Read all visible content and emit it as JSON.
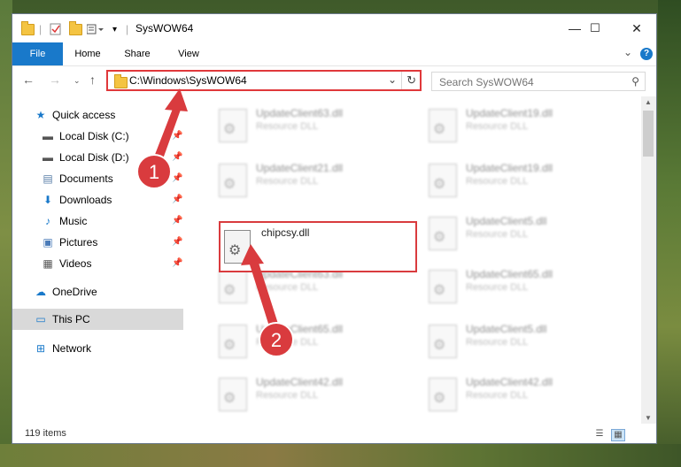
{
  "window": {
    "title": "SysWOW64"
  },
  "controls": {
    "minimize": "—",
    "maximize": "☐",
    "close": "✕"
  },
  "ribbon": {
    "tabs": [
      "File",
      "Home",
      "Share",
      "View"
    ],
    "expand": "⌄",
    "help": "?"
  },
  "address": {
    "path": "C:\\Windows\\SysWOW64"
  },
  "search": {
    "placeholder": "Search SysWOW64"
  },
  "nav": {
    "quick_access": "Quick access",
    "items": [
      {
        "label": "Local Disk (C:)",
        "icon": "drive-icon"
      },
      {
        "label": "Local Disk (D:)",
        "icon": "drive-icon"
      },
      {
        "label": "Documents",
        "icon": "documents-icon"
      },
      {
        "label": "Downloads",
        "icon": "downloads-icon"
      },
      {
        "label": "Music",
        "icon": "music-icon"
      },
      {
        "label": "Pictures",
        "icon": "pictures-icon"
      },
      {
        "label": "Videos",
        "icon": "videos-icon"
      }
    ],
    "onedrive": "OneDrive",
    "this_pc": "This PC",
    "network": "Network"
  },
  "files": {
    "left": [
      {
        "name": "UpdateClient63.dll",
        "type": "Resource DLL"
      },
      {
        "name": "UpdateClient21.dll",
        "type": "Resource DLL"
      },
      {
        "name": "UpdateClient63.dll",
        "type": "Resource DLL"
      },
      {
        "name": "UpdateClient65.dll",
        "type": "Resource DLL"
      },
      {
        "name": "UpdateClient42.dll",
        "type": "Resource DLL"
      }
    ],
    "right": [
      {
        "name": "UpdateClient19.dll",
        "type": "Resource DLL"
      },
      {
        "name": "UpdateClient19.dll",
        "type": "Resource DLL"
      },
      {
        "name": "UpdateClient5.dll",
        "type": "Resource DLL"
      },
      {
        "name": "UpdateClient65.dll",
        "type": "Resource DLL"
      },
      {
        "name": "UpdateClient5.dll",
        "type": "Resource DLL"
      },
      {
        "name": "UpdateClient42.dll",
        "type": "Resource DLL"
      }
    ],
    "selected": {
      "name": "chipcsy.dll"
    }
  },
  "annotations": {
    "step1": "1",
    "step2": "2",
    "color": "#d93b3e"
  },
  "status": {
    "items": "119 items"
  }
}
